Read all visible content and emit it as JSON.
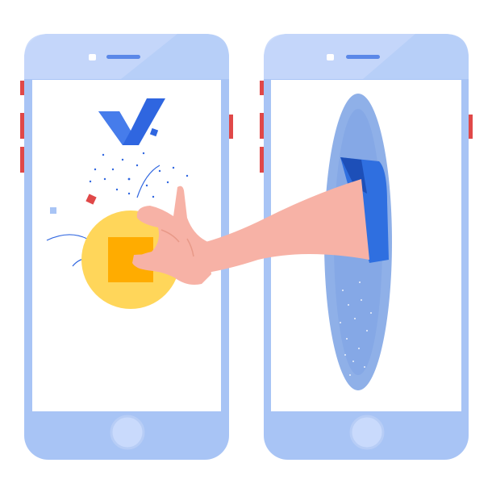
{
  "illustration": {
    "logo_glyph": "V",
    "elements": [
      "phone-left",
      "phone-right",
      "coin",
      "hand",
      "portal"
    ]
  },
  "colors": {
    "phone_body": "#a8c4f5",
    "phone_top": "#c6d8fb",
    "screen": "#ffffff",
    "side_button": "#e04848",
    "home_button": "#c9dafc",
    "logo": "#2f66e0",
    "coin_outer": "#ffd65a",
    "coin_inner": "#ffac00",
    "skin": "#f7b2a6",
    "sleeve": "#2f6fe0",
    "portal": "#8fb0e8",
    "portal_inner": "#6e96dd"
  }
}
